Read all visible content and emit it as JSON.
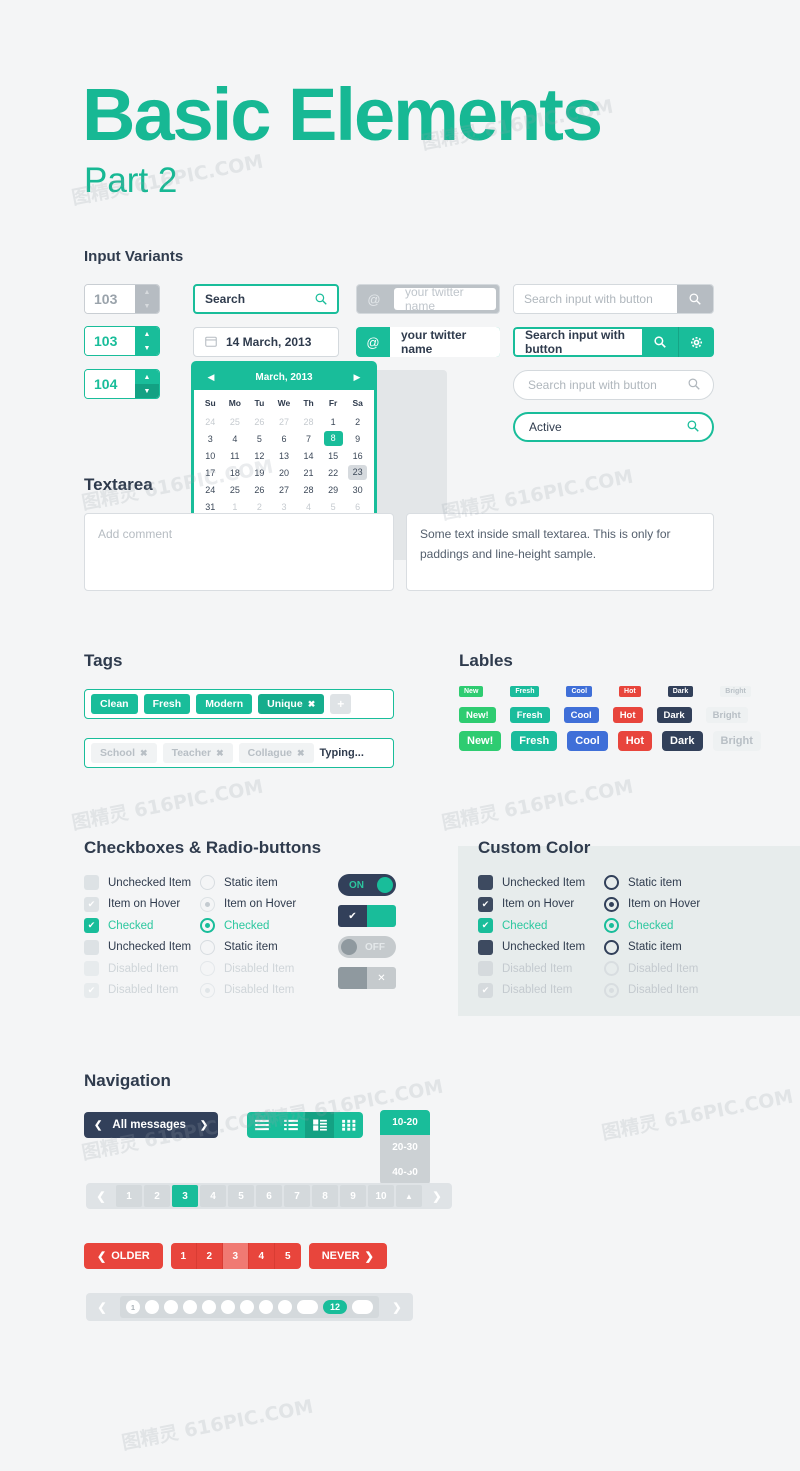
{
  "header": {
    "title": "Basic Elements",
    "subtitle": "Part 2",
    "accent": "#19bd9a"
  },
  "sections": {
    "input_variants": "Input Variants",
    "textarea": "Textarea",
    "tags": "Tags",
    "labels": "Lables",
    "checkboxes": "Checkboxes & Radio-buttons",
    "custom_color": "Custom Color",
    "navigation": "Navigation"
  },
  "spinners": [
    {
      "value": "103",
      "style": "gray"
    },
    {
      "value": "103",
      "style": "teal"
    },
    {
      "value": "104",
      "style": "teal2"
    }
  ],
  "inputs": {
    "search_focused": {
      "value": "Search",
      "icon": "search-icon"
    },
    "date": {
      "value": "14 March, 2013",
      "icon": "calendar-icon"
    },
    "twitter_gray": {
      "addon": "@",
      "placeholder": "your twitter name"
    },
    "twitter_teal": {
      "addon": "@",
      "value": "your twitter name"
    },
    "search_btn_gray": {
      "placeholder": "Search input with button",
      "icon": "search-icon"
    },
    "search_btn_teal": {
      "value": "Search input with button",
      "icons": [
        "search-icon",
        "gear-icon"
      ]
    },
    "search_pill_gray": {
      "placeholder": "Search input with button",
      "icon": "search-icon"
    },
    "search_pill_teal": {
      "value": "Active",
      "icon": "search-icon"
    }
  },
  "calendar": {
    "month_label": "March, 2013",
    "prev_icon": "triangle-left-icon",
    "next_icon": "triangle-right-icon",
    "weekdays": [
      "Su",
      "Mo",
      "Tu",
      "We",
      "Th",
      "Fr",
      "Sa"
    ],
    "weeks": [
      [
        {
          "d": "24",
          "m": true
        },
        {
          "d": "25",
          "m": true
        },
        {
          "d": "26",
          "m": true
        },
        {
          "d": "27",
          "m": true
        },
        {
          "d": "28",
          "m": true
        },
        {
          "d": "1"
        },
        {
          "d": "2"
        }
      ],
      [
        {
          "d": "3"
        },
        {
          "d": "4"
        },
        {
          "d": "5"
        },
        {
          "d": "6"
        },
        {
          "d": "7"
        },
        {
          "d": "8",
          "state": "selected"
        },
        {
          "d": "9"
        }
      ],
      [
        {
          "d": "10"
        },
        {
          "d": "11"
        },
        {
          "d": "12"
        },
        {
          "d": "13"
        },
        {
          "d": "14"
        },
        {
          "d": "15"
        },
        {
          "d": "16"
        }
      ],
      [
        {
          "d": "17"
        },
        {
          "d": "18"
        },
        {
          "d": "19"
        },
        {
          "d": "20"
        },
        {
          "d": "21"
        },
        {
          "d": "22"
        },
        {
          "d": "23",
          "state": "hover"
        }
      ],
      [
        {
          "d": "24"
        },
        {
          "d": "25"
        },
        {
          "d": "26"
        },
        {
          "d": "27"
        },
        {
          "d": "28"
        },
        {
          "d": "29"
        },
        {
          "d": "30"
        }
      ],
      [
        {
          "d": "31"
        },
        {
          "d": "1",
          "m": true
        },
        {
          "d": "2",
          "m": true
        },
        {
          "d": "3",
          "m": true
        },
        {
          "d": "4",
          "m": true
        },
        {
          "d": "5",
          "m": true
        },
        {
          "d": "6",
          "m": true
        }
      ]
    ],
    "selected_day": "8",
    "hover_day": "23"
  },
  "textareas": {
    "left_placeholder": "Add comment",
    "right_value": "Some text inside small textarea. This is only for paddings and line-height sample."
  },
  "tags": {
    "row1": [
      {
        "label": "Clean"
      },
      {
        "label": "Fresh"
      },
      {
        "label": "Modern"
      },
      {
        "label": "Unique",
        "removable": true,
        "active": true
      }
    ],
    "add_label": "+",
    "row2": [
      {
        "label": "School",
        "removable": true
      },
      {
        "label": "Teacher",
        "removable": true
      },
      {
        "label": "Collague",
        "removable": true
      }
    ],
    "typing_text": "Typing..."
  },
  "labels": {
    "items": [
      {
        "small": "New",
        "label": "New!",
        "color": "#2ecc71",
        "text": "#ffffff"
      },
      {
        "small": "Fresh",
        "label": "Fresh",
        "color": "#1abc9c",
        "text": "#ffffff"
      },
      {
        "small": "Cool",
        "label": "Cool",
        "color": "#3f6fd8",
        "text": "#ffffff"
      },
      {
        "small": "Hot",
        "label": "Hot",
        "color": "#e8453c",
        "text": "#ffffff"
      },
      {
        "small": "Dark",
        "label": "Dark",
        "color": "#32405a",
        "text": "#ffffff"
      },
      {
        "small": "Bright",
        "label": "Bright",
        "color": "#eef1f2",
        "text": "#b8bfc5"
      }
    ]
  },
  "checkboxes": {
    "left": [
      {
        "label": "Unchecked Item",
        "state": "unchecked"
      },
      {
        "label": "Item on Hover",
        "state": "hover"
      },
      {
        "label": "Checked",
        "state": "checked"
      },
      {
        "label": "Unchecked Item",
        "state": "unchecked"
      },
      {
        "label": "Disabled Item",
        "state": "disabled"
      },
      {
        "label": "Disabled Item",
        "state": "disabled-checked"
      }
    ],
    "right": [
      {
        "label": "Static item",
        "state": "unchecked"
      },
      {
        "label": "Item on Hover",
        "state": "hover"
      },
      {
        "label": "Checked",
        "state": "checked"
      },
      {
        "label": "Static item",
        "state": "unchecked"
      },
      {
        "label": "Disabled Item",
        "state": "disabled"
      },
      {
        "label": "Disabled Item",
        "state": "disabled-checked"
      }
    ],
    "toggles": [
      {
        "type": "pill",
        "label": "ON",
        "state": "on"
      },
      {
        "type": "square",
        "label": "✔",
        "state": "on"
      },
      {
        "type": "pill",
        "label": "OFF",
        "state": "off"
      },
      {
        "type": "square",
        "label": "✕",
        "state": "off"
      }
    ]
  },
  "custom_color": {
    "accent": "#32405a",
    "left": [
      {
        "label": "Unchecked Item",
        "state": "unchecked"
      },
      {
        "label": "Item on Hover",
        "state": "hover"
      },
      {
        "label": "Checked",
        "state": "checked"
      },
      {
        "label": "Unchecked Item",
        "state": "unchecked"
      },
      {
        "label": "Disabled Item",
        "state": "disabled"
      },
      {
        "label": "Disabled Item",
        "state": "disabled-checked"
      }
    ],
    "right": [
      {
        "label": "Static item",
        "state": "unchecked"
      },
      {
        "label": "Item on Hover",
        "state": "hover"
      },
      {
        "label": "Checked",
        "state": "checked"
      },
      {
        "label": "Static item",
        "state": "unchecked"
      },
      {
        "label": "Disabled Item",
        "state": "disabled"
      },
      {
        "label": "Disabled Item",
        "state": "disabled-checked"
      }
    ]
  },
  "navigation": {
    "messages_button": {
      "label": "All messages",
      "prev_icon": "chevron-left-icon",
      "next_icon": "chevron-right-icon"
    },
    "view_modes": [
      {
        "name": "view-lines-icon",
        "active": false
      },
      {
        "name": "view-list-icon",
        "active": false
      },
      {
        "name": "view-blocks-icon",
        "active": true
      },
      {
        "name": "view-grid-icon",
        "active": false
      }
    ],
    "dropdown": {
      "selected": "10-20",
      "options": [
        "20-30",
        "40-50"
      ],
      "caret_icon": "triangle-up-icon"
    },
    "pagination": {
      "prev_icon": "chevron-left-icon",
      "next_icon": "chevron-right-icon",
      "up_icon": "triangle-up-icon",
      "pages": [
        "1",
        "2",
        "3",
        "4",
        "5",
        "6",
        "7",
        "8",
        "9",
        "10"
      ],
      "current": "3"
    },
    "red_pagination": {
      "older_label": "OLDER",
      "never_label": "NEVER",
      "older_icon": "chevron-left-icon",
      "never_icon": "chevron-right-icon",
      "pages": [
        "1",
        "2",
        "3",
        "4",
        "5"
      ],
      "current": "3"
    },
    "dot_pagination": {
      "prev_icon": "chevron-left-icon",
      "next_icon": "chevron-right-icon",
      "first_label": "1",
      "active_label": "12",
      "dot_count": 9
    }
  },
  "watermarks": [
    "图精灵 616PIC.COM",
    "图精灵 616PIC.COM",
    "图精灵 616PIC.COM",
    "图精灵 616PIC.COM",
    "图精灵 616PIC.COM",
    "图精灵 616PIC.COM",
    "图精灵 616PIC.COM",
    "图精灵 616PIC.COM",
    "图精灵 616PIC.COM",
    "图精灵 616PIC.COM"
  ]
}
